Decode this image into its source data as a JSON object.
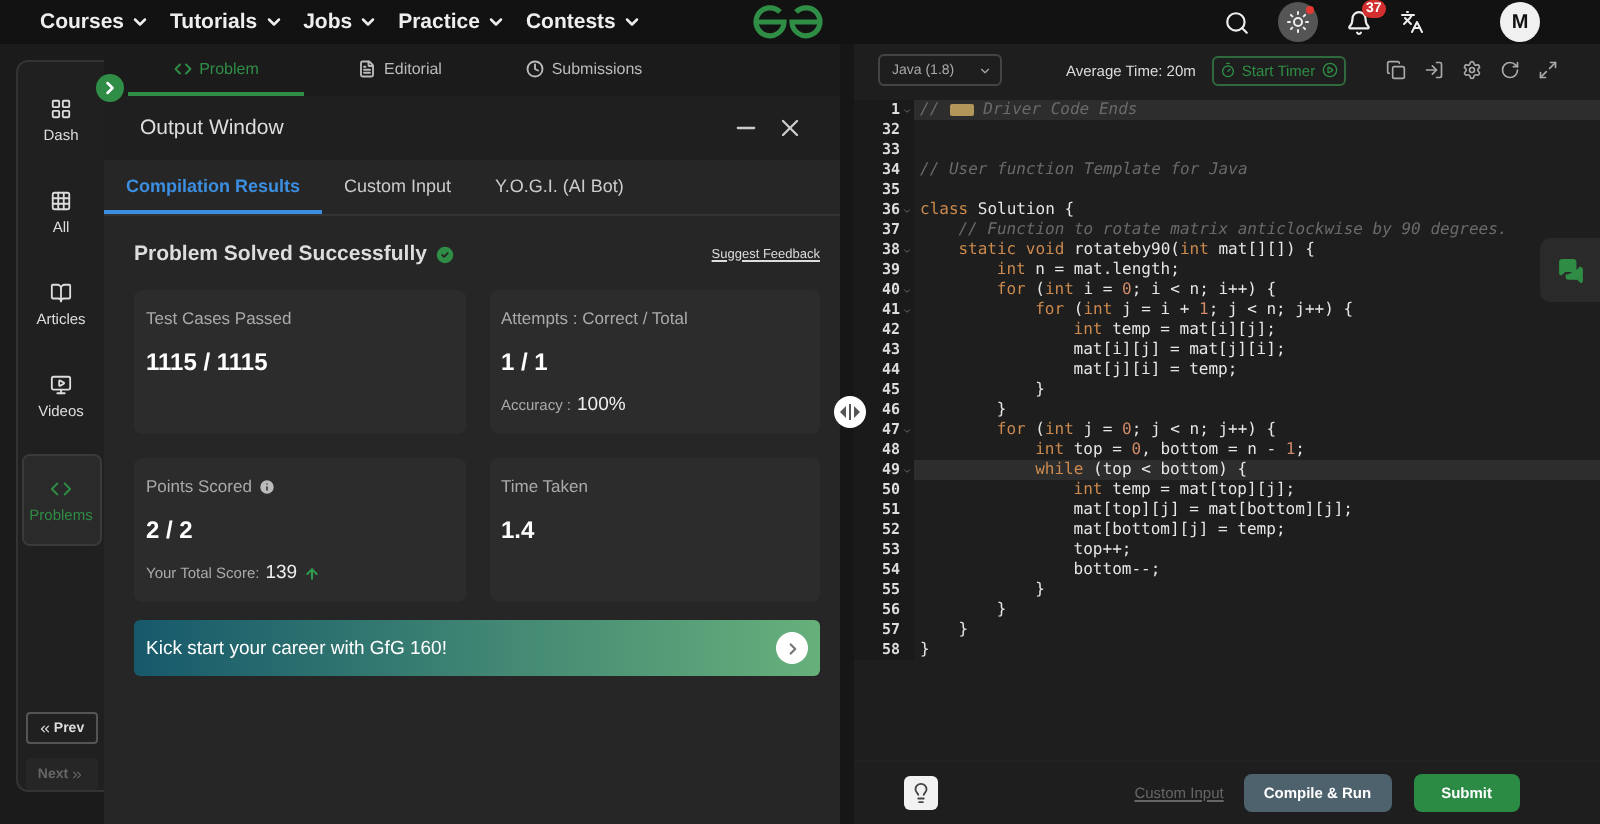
{
  "nav": {
    "items": [
      {
        "label": "Courses"
      },
      {
        "label": "Tutorials"
      },
      {
        "label": "Jobs"
      },
      {
        "label": "Practice"
      },
      {
        "label": "Contests"
      }
    ],
    "notification_count": "37",
    "avatar": "M"
  },
  "sidebar": {
    "items": [
      {
        "label": "Dash",
        "selected": false
      },
      {
        "label": "All",
        "selected": false
      },
      {
        "label": "Articles",
        "selected": false
      },
      {
        "label": "Videos",
        "selected": false
      },
      {
        "label": "Problems",
        "selected": true
      }
    ],
    "prev": {
      "label": "Prev",
      "disabled": false
    },
    "next": {
      "label": "Next",
      "disabled": true
    }
  },
  "problem_tabs": [
    {
      "label": "Problem",
      "selected": true
    },
    {
      "label": "Editorial",
      "selected": false
    },
    {
      "label": "Submissions",
      "selected": false
    }
  ],
  "output_window": {
    "title": "Output Window",
    "tabs": [
      {
        "label": "Compilation Results",
        "selected": true
      },
      {
        "label": "Custom Input",
        "selected": false
      },
      {
        "label": "Y.O.G.I. (AI Bot)",
        "selected": false
      }
    ],
    "status": "Problem Solved Successfully",
    "success": true,
    "feedback_link": "Suggest Feedback",
    "cards": [
      {
        "label": "Test Cases Passed",
        "value": "1115 / 1115",
        "info": false,
        "rising": false
      },
      {
        "label": "Attempts : Correct / Total",
        "value": "1 / 1",
        "info": false,
        "rising": false,
        "note_label": "Accuracy :",
        "note_value": "100%"
      },
      {
        "label": "Points Scored",
        "value": "2 / 2",
        "info": true,
        "rising": true,
        "note_label": "Your Total Score:",
        "note_value": "139"
      },
      {
        "label": "Time Taken",
        "value": "1.4",
        "info": false,
        "rising": false
      }
    ],
    "banner": "Kick start your career with GfG 160!"
  },
  "editor": {
    "language": "Java (1.8)",
    "average_time": "Average Time: 20m",
    "timer_button": "Start Timer",
    "lines": [
      {
        "number": "1",
        "foldable": true,
        "highlighted": true,
        "tokens": [
          {
            "kind": "comment",
            "text": "//"
          },
          {
            "kind": "fold"
          },
          {
            "kind": "comment",
            "text": "Driver Code Ends"
          }
        ]
      },
      {
        "number": "32",
        "foldable": false,
        "highlighted": false
      },
      {
        "number": "33",
        "foldable": false,
        "highlighted": false
      },
      {
        "number": "34",
        "foldable": false,
        "highlighted": false,
        "tokens": [
          {
            "kind": "comment",
            "text": "// User function Template for Java"
          }
        ]
      },
      {
        "number": "35",
        "foldable": false,
        "highlighted": false
      },
      {
        "number": "36",
        "foldable": true,
        "highlighted": false,
        "tokens": [
          {
            "kind": "keyword",
            "text": "class"
          },
          {
            "kind": "plain",
            "text": " Solution {"
          }
        ]
      },
      {
        "number": "37",
        "foldable": false,
        "highlighted": false,
        "tokens": [
          {
            "kind": "comment",
            "text": "// Function to rotate matrix anticlockwise by 90 degrees."
          }
        ]
      },
      {
        "number": "38",
        "foldable": true,
        "highlighted": false,
        "tokens": [
          {
            "kind": "keyword",
            "text": "static void"
          },
          {
            "kind": "plain",
            "text": " rotateby90("
          },
          {
            "kind": "keyword",
            "text": "int"
          },
          {
            "kind": "plain",
            "text": " mat[][]) {"
          }
        ]
      },
      {
        "number": "39",
        "foldable": false,
        "highlighted": false,
        "tokens": [
          {
            "kind": "keyword",
            "text": "int"
          },
          {
            "kind": "plain",
            "text": " n = mat.length;"
          }
        ]
      },
      {
        "number": "40",
        "foldable": true,
        "highlighted": false,
        "tokens": [
          {
            "kind": "keyword",
            "text": "for"
          },
          {
            "kind": "plain",
            "text": " ("
          },
          {
            "kind": "keyword",
            "text": "int"
          },
          {
            "kind": "plain",
            "text": " i = "
          },
          {
            "kind": "number",
            "text": "0"
          },
          {
            "kind": "plain",
            "text": "; i < n; i++) {"
          }
        ]
      },
      {
        "number": "41",
        "foldable": true,
        "highlighted": false,
        "tokens": [
          {
            "kind": "keyword",
            "text": "for"
          },
          {
            "kind": "plain",
            "text": " ("
          },
          {
            "kind": "keyword",
            "text": "int"
          },
          {
            "kind": "plain",
            "text": " j = i + "
          },
          {
            "kind": "number",
            "text": "1"
          },
          {
            "kind": "plain",
            "text": "; j < n; j++) {"
          }
        ]
      },
      {
        "number": "42",
        "foldable": false,
        "highlighted": false,
        "tokens": [
          {
            "kind": "keyword",
            "text": "int"
          },
          {
            "kind": "plain",
            "text": " temp = mat[i][j];"
          }
        ]
      },
      {
        "number": "43",
        "foldable": false,
        "highlighted": false,
        "tokens": [
          {
            "kind": "plain",
            "text": "mat[i][j] = mat[j][i];"
          }
        ]
      },
      {
        "number": "44",
        "foldable": false,
        "highlighted": false,
        "tokens": [
          {
            "kind": "plain",
            "text": "mat[j][i] = temp;"
          }
        ]
      },
      {
        "number": "45",
        "foldable": false,
        "highlighted": false,
        "tokens": [
          {
            "kind": "plain",
            "text": "}"
          }
        ]
      },
      {
        "number": "46",
        "foldable": false,
        "highlighted": false,
        "tokens": [
          {
            "kind": "plain",
            "text": "}"
          }
        ]
      },
      {
        "number": "47",
        "foldable": true,
        "highlighted": false,
        "tokens": [
          {
            "kind": "keyword",
            "text": "for"
          },
          {
            "kind": "plain",
            "text": " ("
          },
          {
            "kind": "keyword",
            "text": "int"
          },
          {
            "kind": "plain",
            "text": " j = "
          },
          {
            "kind": "number",
            "text": "0"
          },
          {
            "kind": "plain",
            "text": "; j < n; j++) {"
          }
        ]
      },
      {
        "number": "48",
        "foldable": false,
        "highlighted": false,
        "tokens": [
          {
            "kind": "keyword",
            "text": "int"
          },
          {
            "kind": "plain",
            "text": " top = "
          },
          {
            "kind": "number",
            "text": "0"
          },
          {
            "kind": "plain",
            "text": ", bottom = n - "
          },
          {
            "kind": "number",
            "text": "1"
          },
          {
            "kind": "plain",
            "text": ";"
          }
        ]
      },
      {
        "number": "49",
        "foldable": true,
        "highlighted": true,
        "tokens": [
          {
            "kind": "keyword",
            "text": "while"
          },
          {
            "kind": "plain",
            "text": " (top < bottom) {"
          }
        ]
      },
      {
        "number": "50",
        "foldable": false,
        "highlighted": false,
        "tokens": [
          {
            "kind": "keyword",
            "text": "int"
          },
          {
            "kind": "plain",
            "text": " temp = mat[top][j];"
          }
        ]
      },
      {
        "number": "51",
        "foldable": false,
        "highlighted": false,
        "tokens": [
          {
            "kind": "plain",
            "text": "mat[top][j] = mat[bottom][j];"
          }
        ]
      },
      {
        "number": "52",
        "foldable": false,
        "highlighted": false,
        "tokens": [
          {
            "kind": "plain",
            "text": "mat[bottom][j] = temp;"
          }
        ]
      },
      {
        "number": "53",
        "foldable": false,
        "highlighted": false,
        "tokens": [
          {
            "kind": "plain",
            "text": "top++;"
          }
        ]
      },
      {
        "number": "54",
        "foldable": false,
        "highlighted": false,
        "tokens": [
          {
            "kind": "plain",
            "text": "bottom--;"
          }
        ]
      },
      {
        "number": "55",
        "foldable": false,
        "highlighted": false,
        "tokens": [
          {
            "kind": "plain",
            "text": "}"
          }
        ]
      },
      {
        "number": "56",
        "foldable": false,
        "highlighted": false,
        "tokens": [
          {
            "kind": "plain",
            "text": "}"
          }
        ]
      },
      {
        "number": "57",
        "foldable": false,
        "highlighted": false,
        "tokens": [
          {
            "kind": "plain",
            "text": "}"
          }
        ]
      },
      {
        "number": "58",
        "foldable": false,
        "highlighted": false,
        "tokens": [
          {
            "kind": "plain",
            "text": "}"
          }
        ]
      }
    ],
    "custom_input": {
      "label": "Custom Input",
      "disabled": true
    },
    "compile_button": "Compile & Run",
    "submit_button": "Submit"
  }
}
